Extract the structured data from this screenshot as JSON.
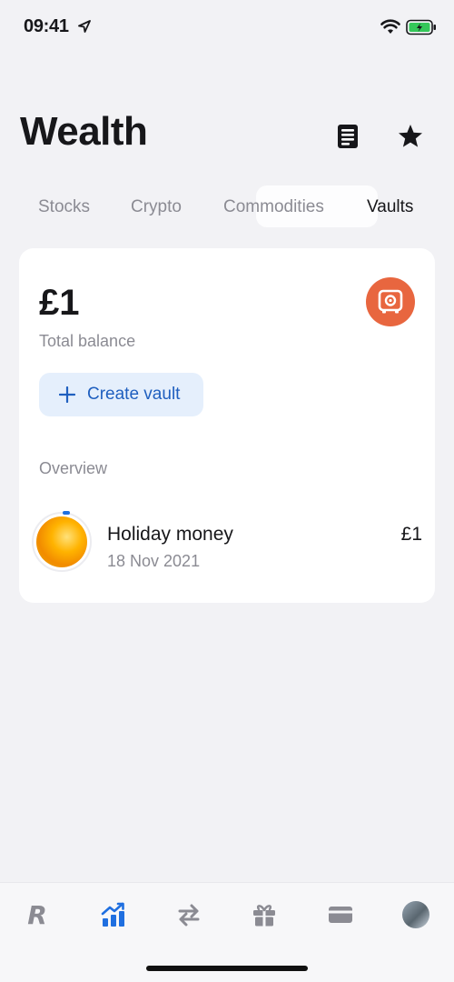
{
  "status": {
    "time": "09:41"
  },
  "header": {
    "title": "Wealth"
  },
  "tabs": [
    {
      "label": "Stocks"
    },
    {
      "label": "Crypto"
    },
    {
      "label": "Commodities"
    },
    {
      "label": "Vaults",
      "active": true
    }
  ],
  "card": {
    "balance": "£1",
    "balance_label": "Total balance",
    "create_label": "Create vault",
    "overview_label": "Overview",
    "vaults": [
      {
        "name": "Holiday money",
        "date": "18 Nov 2021",
        "amount": "£1"
      }
    ]
  },
  "colors": {
    "accent": "#1f5fbf",
    "vault_badge": "#e8663f",
    "background": "#f2f2f5"
  },
  "tabbar": {
    "items": [
      {
        "icon": "revolut-r-icon"
      },
      {
        "icon": "wealth-chart-icon",
        "active": true
      },
      {
        "icon": "transfer-arrows-icon"
      },
      {
        "icon": "gift-icon"
      },
      {
        "icon": "card-icon"
      },
      {
        "icon": "profile-avatar"
      }
    ]
  }
}
